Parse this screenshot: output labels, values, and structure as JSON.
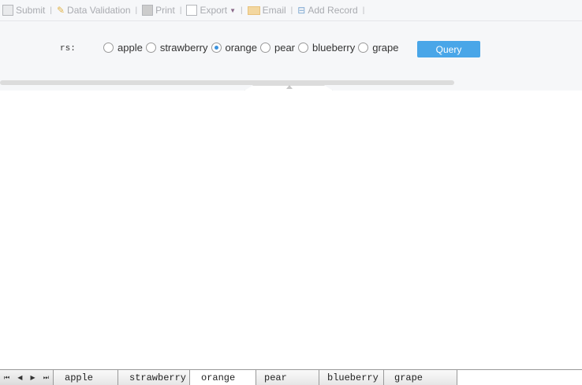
{
  "toolbar": {
    "items": [
      "Submit",
      "Data Validation",
      "Print",
      "Export",
      "Email",
      "Add Record"
    ]
  },
  "form": {
    "label": "rs:",
    "options": [
      "apple",
      "strawberry",
      "orange",
      "pear",
      "blueberry",
      "grape"
    ],
    "selected": "orange",
    "query_label": "Query",
    "accent": "#49a6e8"
  },
  "sheet_tabs": {
    "nav": [
      "⏮",
      "◀",
      "▶",
      "⏭"
    ],
    "tabs": [
      "apple",
      "strawberry",
      "orange",
      "pear",
      "blueberry",
      "grape"
    ],
    "active": "orange"
  }
}
